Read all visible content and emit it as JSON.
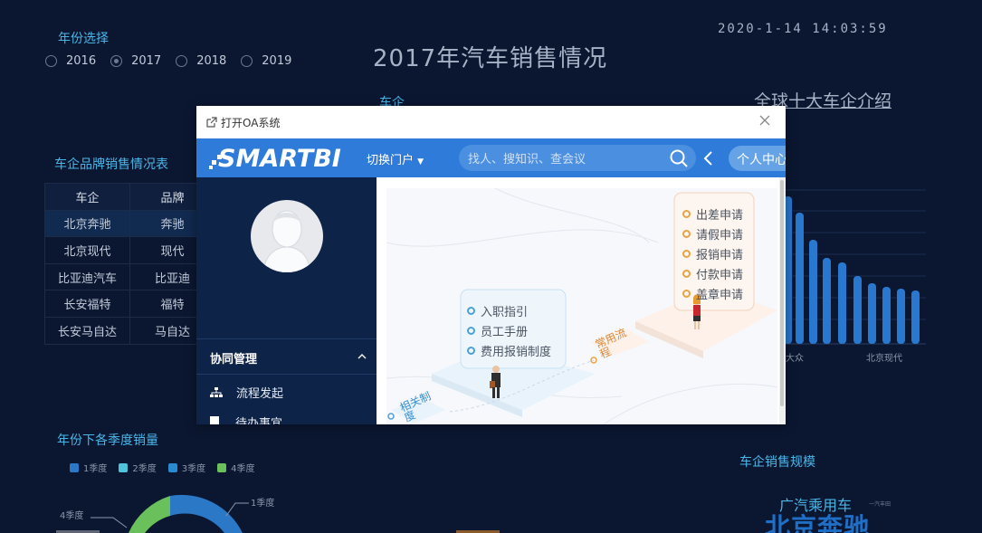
{
  "year_select": {
    "title": "年份选择",
    "options": [
      "2016",
      "2017",
      "2018",
      "2019"
    ],
    "selected": "2017"
  },
  "header": {
    "title": "2017年汽车销售情况",
    "datetime": "2020-1-14 14:03:59"
  },
  "top_chart_title": "车企",
  "global_title": "全球十大车企介绍",
  "brand_table": {
    "title": "车企品牌销售情况表",
    "columns": [
      "车企",
      "品牌"
    ],
    "rows": [
      [
        "北京奔驰",
        "奔驰"
      ],
      [
        "北京现代",
        "现代"
      ],
      [
        "比亚迪汽车",
        "比亚迪"
      ],
      [
        "长安福特",
        "福特"
      ],
      [
        "长安马自达",
        "马自达"
      ]
    ]
  },
  "bar_chart": {
    "x_labels": [
      "大众",
      "北京现代"
    ]
  },
  "season_chart": {
    "title": "年份下各季度销量",
    "legend": [
      "1季度",
      "2季度",
      "3季度",
      "4季度"
    ],
    "callouts": [
      "4季度",
      "1季度"
    ],
    "colors": [
      "#2a78c6",
      "#4fc3d9",
      "#2a8ad0",
      "#6ac15b"
    ]
  },
  "scale_chart": {
    "title": "车企销售规模",
    "words": [
      "广汽乘用车",
      "一汽丰田",
      "北京奔驰"
    ]
  },
  "modal": {
    "title": "打开OA系统",
    "logo": "SMARTBI",
    "switch_label": "切换门户",
    "search_placeholder": "找人、搜知识、查会议",
    "personal_label": "个人中心",
    "side_section": "协同管理",
    "side_items": [
      "流程发起",
      "待办事宜"
    ],
    "content": {
      "right_list": [
        "出差申请",
        "请假申请",
        "报销申请",
        "付款申请",
        "盖章申请"
      ],
      "left_list": [
        "入职指引",
        "员工手册",
        "费用报销制度"
      ],
      "tag_common": "常用流程",
      "tag_related": "相关制度"
    }
  }
}
